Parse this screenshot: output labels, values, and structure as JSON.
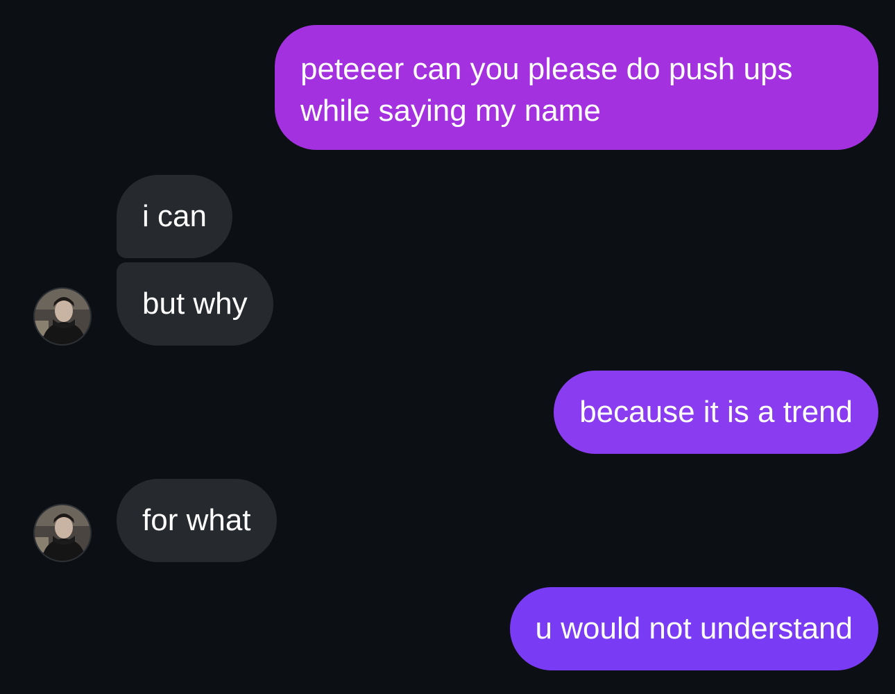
{
  "conversation": {
    "messages": [
      {
        "sender": "me",
        "text": "peteeer can you please do push ups while saying my name"
      },
      {
        "sender": "them",
        "text": "i can"
      },
      {
        "sender": "them",
        "text": "but why"
      },
      {
        "sender": "me",
        "text": "because it is a trend"
      },
      {
        "sender": "them",
        "text": "for what"
      },
      {
        "sender": "me",
        "text": "u would not understand"
      }
    ]
  },
  "contact": {
    "avatar_icon": "profile-photo"
  },
  "colors": {
    "background": "#0c1014",
    "incoming_bubble": "#262a2f",
    "outgoing_top": "#a331e0",
    "outgoing_middle": "#8a3df0",
    "outgoing_bottom": "#7a3bf5",
    "text": "#ffffff"
  }
}
